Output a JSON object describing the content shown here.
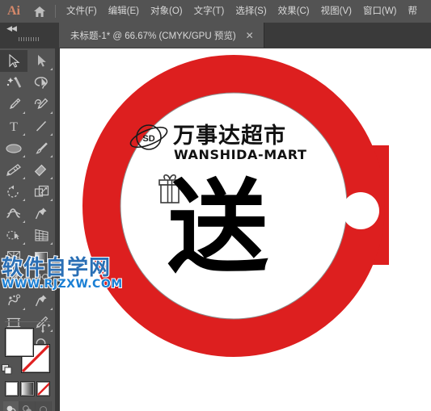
{
  "app": {
    "name": "Ai",
    "logo_label": "Ai",
    "home_icon": "home-icon"
  },
  "menubar": {
    "items": [
      {
        "label": "文件(F)",
        "name": "menu-file"
      },
      {
        "label": "编辑(E)",
        "name": "menu-edit"
      },
      {
        "label": "对象(O)",
        "name": "menu-object"
      },
      {
        "label": "文字(T)",
        "name": "menu-type"
      },
      {
        "label": "选择(S)",
        "name": "menu-select"
      },
      {
        "label": "效果(C)",
        "name": "menu-effect"
      },
      {
        "label": "视图(V)",
        "name": "menu-view"
      },
      {
        "label": "窗口(W)",
        "name": "menu-window"
      },
      {
        "label": "帮",
        "name": "menu-help-truncated"
      }
    ]
  },
  "tabbar": {
    "collapse_glyph": "◀◀",
    "document_tab": {
      "title": "未标题-1* @ 66.67% (CMYK/GPU 预览)",
      "close_glyph": "✕"
    }
  },
  "toolbar": {
    "tools": [
      {
        "name": "selection-tool",
        "active": true,
        "corner": false
      },
      {
        "name": "direct-selection-tool",
        "active": false,
        "corner": true
      },
      {
        "name": "magic-wand-tool",
        "active": false,
        "corner": false
      },
      {
        "name": "lasso-tool",
        "active": false,
        "corner": false
      },
      {
        "name": "pen-tool",
        "active": false,
        "corner": true
      },
      {
        "name": "curvature-tool",
        "active": false,
        "corner": true
      },
      {
        "name": "type-tool",
        "active": false,
        "corner": true
      },
      {
        "name": "line-segment-tool",
        "active": false,
        "corner": true
      },
      {
        "name": "ellipse-tool",
        "active": false,
        "corner": true
      },
      {
        "name": "paintbrush-tool",
        "active": false,
        "corner": true
      },
      {
        "name": "shaper-tool",
        "active": false,
        "corner": true
      },
      {
        "name": "eraser-tool",
        "active": false,
        "corner": true
      },
      {
        "name": "rotate-tool",
        "active": false,
        "corner": true
      },
      {
        "name": "scale-tool",
        "active": false,
        "corner": true
      },
      {
        "name": "width-tool",
        "active": false,
        "corner": true
      },
      {
        "name": "free-transform-tool",
        "active": false,
        "corner": false
      },
      {
        "name": "shape-builder-tool",
        "active": false,
        "corner": true
      },
      {
        "name": "perspective-grid-tool",
        "active": false,
        "corner": true
      },
      {
        "name": "mesh-tool",
        "active": false,
        "corner": false
      },
      {
        "name": "gradient-tool",
        "active": false,
        "corner": false
      },
      {
        "name": "eyedropper-tool",
        "active": false,
        "corner": true
      },
      {
        "name": "blend-tool",
        "active": false,
        "corner": true
      },
      {
        "name": "symbol-sprayer-tool",
        "active": false,
        "corner": true
      },
      {
        "name": "column-graph-tool",
        "active": false,
        "corner": true
      },
      {
        "name": "artboard-tool",
        "active": false,
        "corner": false
      },
      {
        "name": "slice-tool",
        "active": false,
        "corner": true
      },
      {
        "name": "hand-tool",
        "active": false,
        "corner": true
      },
      {
        "name": "zoom-tool",
        "active": false,
        "corner": false
      }
    ],
    "fill_color": "#ffffff",
    "stroke_color": "#ffffff",
    "stroke_is_none": true,
    "swatch_names": {
      "fill": "fill-color-swatch",
      "stroke": "stroke-color-swatch",
      "swap": "swap-fill-stroke-icon",
      "default": "default-fill-stroke-icon"
    },
    "paint_modes": [
      {
        "name": "color-mode-button",
        "label": "solid"
      },
      {
        "name": "gradient-mode-button",
        "label": "gradient"
      },
      {
        "name": "none-mode-button",
        "label": "none"
      }
    ],
    "draw_modes": [
      {
        "name": "draw-normal-button"
      },
      {
        "name": "draw-behind-button"
      },
      {
        "name": "draw-inside-button"
      }
    ]
  },
  "artwork": {
    "shape_name": "supermarket-tag-badge",
    "ring_color": "#dd1f1f",
    "tab_color": "#dd1f1f",
    "inner_circle_color": "#ffffff",
    "inner_outline_color": "#8c8c8c",
    "hole_color": "#ffffff",
    "logo": {
      "badge_text": "SD",
      "cn_name": "万事达超市",
      "en_name": "WANSHIDA-MART",
      "planet_icon": "saturn-planet-icon"
    },
    "headline": {
      "character": "送",
      "gift_icon": "gift-box-icon",
      "color": "#000000"
    }
  },
  "watermark": {
    "cn": "软件自学网",
    "en": "WWW.RJZXW.COM",
    "color_cn": "#2a6fb5",
    "color_en": "#1a7fd4"
  }
}
